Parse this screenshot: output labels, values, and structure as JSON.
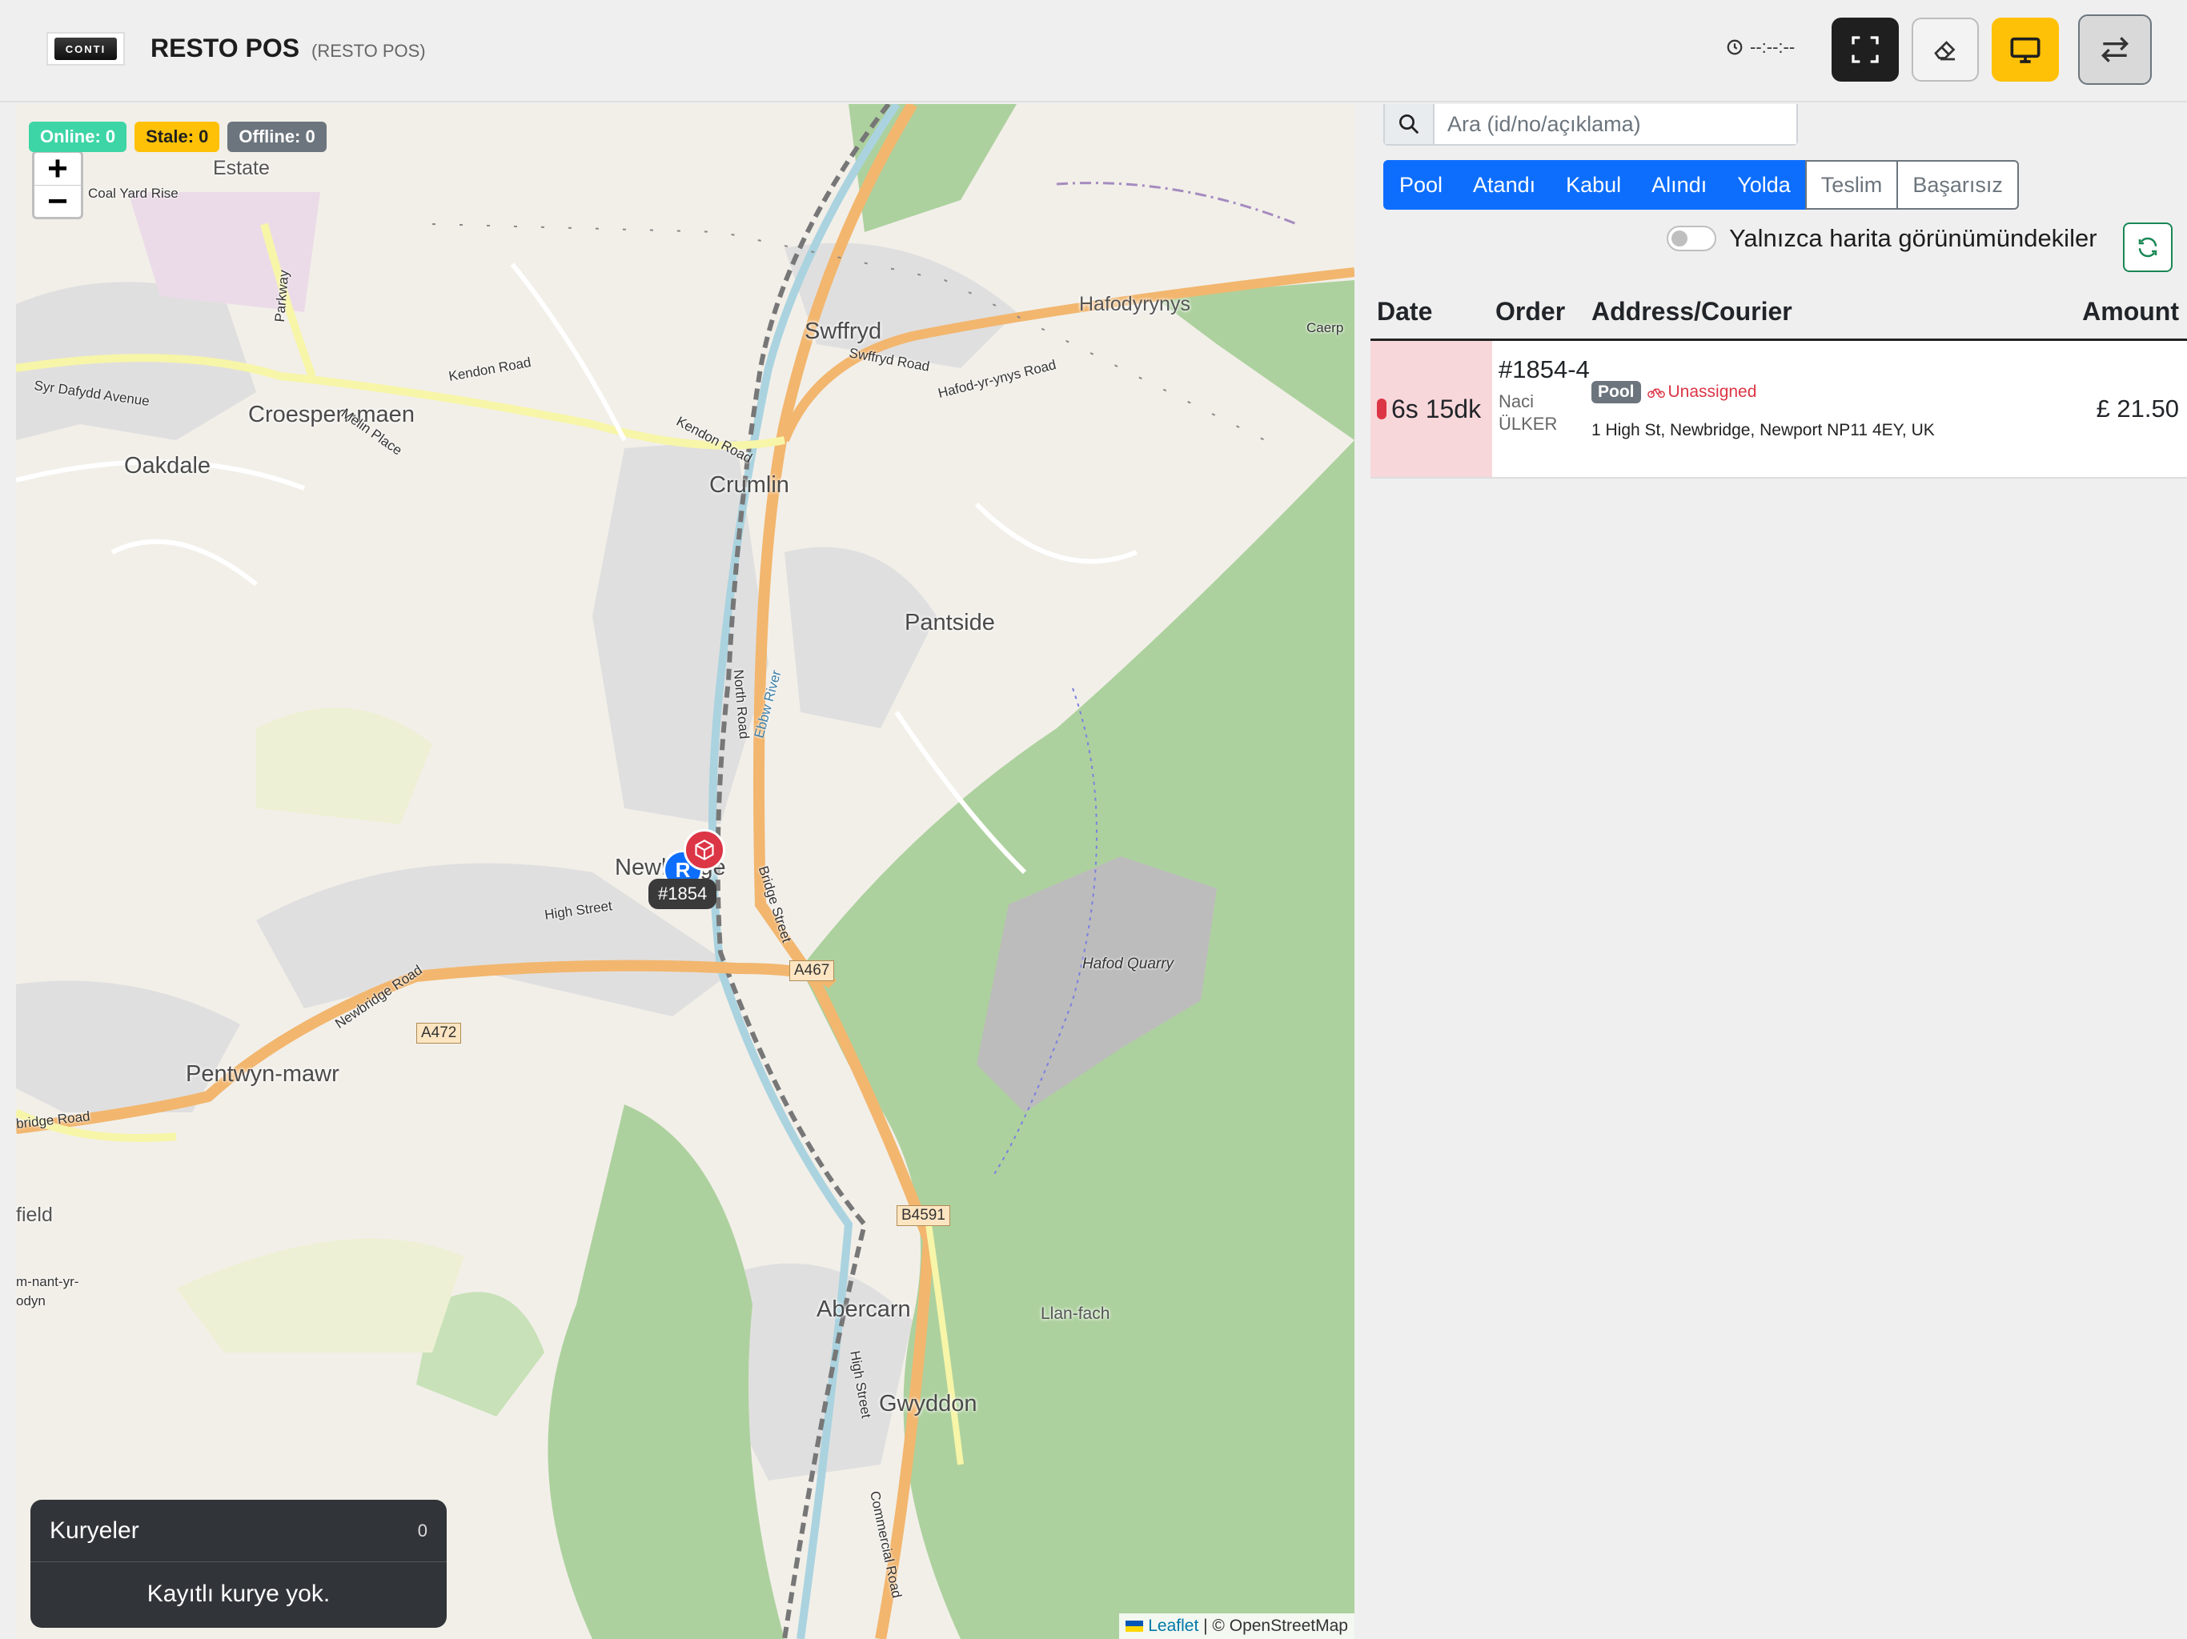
{
  "header": {
    "app_title": "RESTO POS",
    "app_subtitle": "(RESTO POS)",
    "logo_text": "CONTI",
    "clock": "--:--:--",
    "buttons": {
      "fullscreen_icon": "fullscreen-icon",
      "eraser_icon": "eraser-icon",
      "monitor_icon": "monitor-icon",
      "swap_icon": "swap-arrows-icon"
    }
  },
  "map": {
    "status": {
      "online": "Online: 0",
      "stale": "Stale: 0",
      "offline": "Offline: 0"
    },
    "zoom_in": "+",
    "zoom_out": "−",
    "places": {
      "estate": "Estate",
      "coal_yard_rise": "Coal Yard Rise",
      "croespen_maen": "Croespen-maen",
      "oakdale": "Oakdale",
      "syr_dafydd": "Syr Dafydd Avenue",
      "melin_place": "Melin Place",
      "parkway": "Parkway",
      "kendon_road_1": "Kendon Road",
      "kendon_road_2": "Kendon Road",
      "swffryd": "Swffryd",
      "swffryd_road": "Swffryd Road",
      "hafod_yr_ynys_road": "Hafod-yr-ynys Road",
      "hafodyrynys": "Hafodyrynys",
      "caerp": "Caerp",
      "crumlin": "Crumlin",
      "pantside": "Pantside",
      "north_road": "North Road",
      "ebbw_river": "Ebbw River",
      "newbridge": "Newbridge",
      "high_street": "High Street",
      "bridge_street": "Bridge Street",
      "newbridge_road": "Newbridge Road",
      "pentwyn_mawr": "Pentwyn-mawr",
      "bridge_road": "bridge Road",
      "field": "field",
      "nant_yr_odyn": "m-nant-yr-odyn",
      "hafod_quarry": "Hafod Quarry",
      "abercarn": "Abercarn",
      "llan_fach": "Llan-fach",
      "gwyddon": "Gwyddon",
      "high_street_2": "High Street",
      "commercial_road": "Commercial Road",
      "a467": "A467",
      "a472": "A472",
      "b4591": "B4591"
    },
    "restaurant_marker": "R",
    "order_tag": "#1854",
    "attribution": {
      "leaflet": "Leaflet",
      "osm": "| © OpenStreetMap"
    },
    "couriers": {
      "title": "Kuryeler",
      "count": "0",
      "empty": "Kayıtlı kurye yok."
    }
  },
  "panel": {
    "search_placeholder": "Ara (id/no/açıklama)",
    "filters": [
      {
        "label": "Pool",
        "active": true
      },
      {
        "label": "Atandı",
        "active": true
      },
      {
        "label": "Kabul",
        "active": true
      },
      {
        "label": "Alındı",
        "active": true
      },
      {
        "label": "Yolda",
        "active": true
      },
      {
        "label": "Teslim",
        "active": false
      },
      {
        "label": "Başarısız",
        "active": false
      }
    ],
    "only_map_view_label": "Yalnızca harita görünümündekiler",
    "table": {
      "headers": {
        "date": "Date",
        "order": "Order",
        "address": "Address/Courier",
        "amount": "Amount"
      },
      "rows": [
        {
          "age": "6s 15dk",
          "order_no": "#1854-4",
          "courier_name": "Naci ÜLKER",
          "status_badge": "Pool",
          "courier_status": "Unassigned",
          "address": "1 High St, Newbridge, Newport NP11 4EY, UK",
          "amount": "£ 21.50"
        }
      ]
    }
  },
  "colors": {
    "primary": "#0d6efd",
    "danger": "#dc3545",
    "warning": "#ffc107",
    "success_online": "#3dd5a5",
    "secondary": "#6c757d"
  }
}
